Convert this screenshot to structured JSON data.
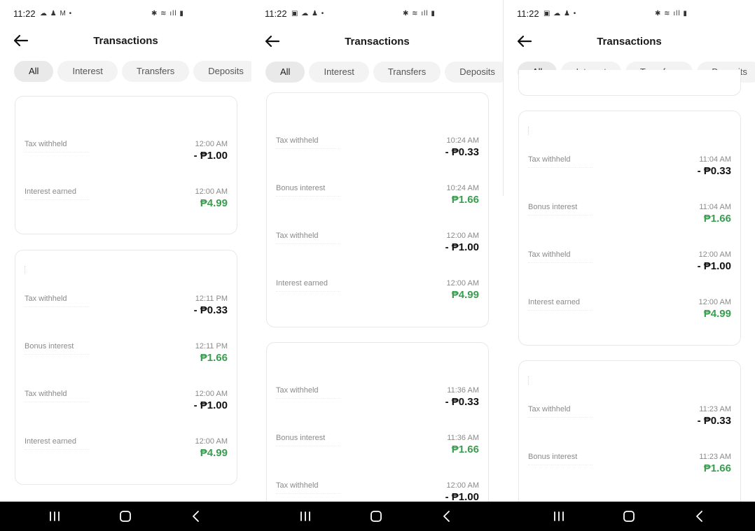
{
  "screens": [
    {
      "status": {
        "time": "11:22",
        "left_icons": "☁ ♟ M •",
        "right_icons": "✱ ≋ ıll ▮"
      },
      "header": {
        "title": "Transactions",
        "back_icon": "arrow-left-icon"
      },
      "filters": [
        "All",
        "Interest",
        "Transfers",
        "Deposits"
      ],
      "cards": [
        {
          "rows": [
            {
              "label": "Tax withheld",
              "time": "12:00 AM",
              "amount": "- ₱1.00",
              "type": "debit"
            },
            {
              "label": "Interest earned",
              "time": "12:00 AM",
              "amount": "₱4.99",
              "type": "credit"
            }
          ]
        },
        {
          "rows": [
            {
              "label": "Tax withheld",
              "time": "12:11 PM",
              "amount": "- ₱0.33",
              "type": "debit"
            },
            {
              "label": "Bonus interest",
              "time": "12:11 PM",
              "amount": "₱1.66",
              "type": "credit"
            },
            {
              "label": "Tax withheld",
              "time": "12:00 AM",
              "amount": "- ₱1.00",
              "type": "debit"
            },
            {
              "label": "Interest earned",
              "time": "12:00 AM",
              "amount": "₱4.99",
              "type": "credit"
            }
          ]
        }
      ]
    },
    {
      "status": {
        "time": "11:22",
        "left_icons": "▣ ☁ ♟ •",
        "right_icons": "✱ ≋ ıll ▮"
      },
      "header": {
        "title": "Transactions",
        "back_icon": "arrow-left-icon"
      },
      "filters": [
        "All",
        "Interest",
        "Transfers",
        "Deposits"
      ],
      "cards": [
        {
          "rows": [
            {
              "label": "Tax withheld",
              "time": "10:24 AM",
              "amount": "- ₱0.33",
              "type": "debit"
            },
            {
              "label": "Bonus interest",
              "time": "10:24 AM",
              "amount": "₱1.66",
              "type": "credit"
            },
            {
              "label": "Tax withheld",
              "time": "12:00 AM",
              "amount": "- ₱1.00",
              "type": "debit"
            },
            {
              "label": "Interest earned",
              "time": "12:00 AM",
              "amount": "₱4.99",
              "type": "credit"
            }
          ]
        },
        {
          "rows": [
            {
              "label": "Tax withheld",
              "time": "11:36 AM",
              "amount": "- ₱0.33",
              "type": "debit"
            },
            {
              "label": "Bonus interest",
              "time": "11:36 AM",
              "amount": "₱1.66",
              "type": "credit"
            },
            {
              "label": "Tax withheld",
              "time": "12:00 AM",
              "amount": "- ₱1.00",
              "type": "debit"
            }
          ]
        }
      ]
    },
    {
      "status": {
        "time": "11:22",
        "left_icons": "▣ ☁ ♟ •",
        "right_icons": "✱ ≋ ıll ▮"
      },
      "header": {
        "title": "Transactions",
        "back_icon": "arrow-left-icon"
      },
      "filters": [
        "All",
        "Interest",
        "Transfers",
        "Deposits"
      ],
      "cards": [
        {
          "rows": []
        },
        {
          "rows": [
            {
              "label": "Tax withheld",
              "time": "11:04 AM",
              "amount": "- ₱0.33",
              "type": "debit"
            },
            {
              "label": "Bonus interest",
              "time": "11:04 AM",
              "amount": "₱1.66",
              "type": "credit"
            },
            {
              "label": "Tax withheld",
              "time": "12:00 AM",
              "amount": "- ₱1.00",
              "type": "debit"
            },
            {
              "label": "Interest earned",
              "time": "12:00 AM",
              "amount": "₱4.99",
              "type": "credit"
            }
          ]
        },
        {
          "rows": [
            {
              "label": "Tax withheld",
              "time": "11:23 AM",
              "amount": "- ₱0.33",
              "type": "debit"
            },
            {
              "label": "Bonus interest",
              "time": "11:23 AM",
              "amount": "₱1.66",
              "type": "credit"
            }
          ]
        }
      ]
    }
  ],
  "nav": {
    "recents_icon": "recents-icon",
    "home_icon": "home-icon",
    "back_icon": "nav-back-icon"
  },
  "colors": {
    "credit": "#3a9d50",
    "debit": "#111111",
    "chip_bg": "#f3f3f3",
    "nav_bg": "#000000"
  }
}
